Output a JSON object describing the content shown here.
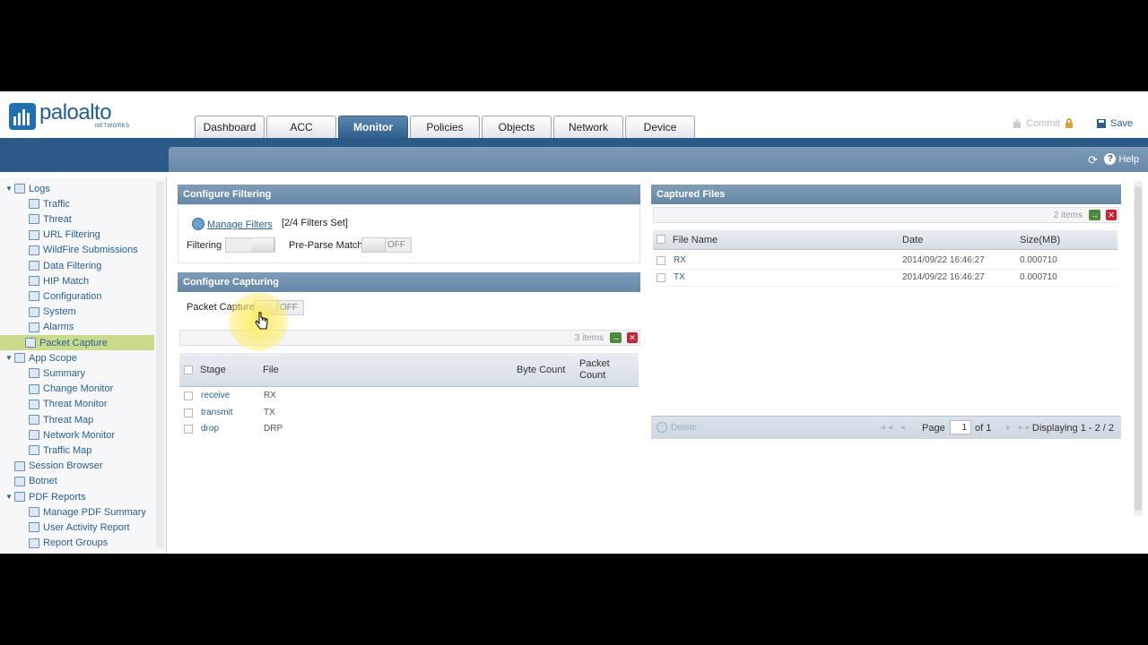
{
  "brand": {
    "name": "paloalto",
    "sub": "NETWORKS",
    "color": "#1f5e99"
  },
  "tabs": [
    {
      "label": "Dashboard",
      "active": false
    },
    {
      "label": "ACC",
      "active": false
    },
    {
      "label": "Monitor",
      "active": true
    },
    {
      "label": "Policies",
      "active": false
    },
    {
      "label": "Objects",
      "active": false
    },
    {
      "label": "Network",
      "active": false
    },
    {
      "label": "Device",
      "active": false
    }
  ],
  "header_actions": {
    "commit": "Commit",
    "save": "Save",
    "help": "Help"
  },
  "sidebar": {
    "items": [
      {
        "label": "Logs",
        "level": 0,
        "expanded": true
      },
      {
        "label": "Traffic",
        "level": 1
      },
      {
        "label": "Threat",
        "level": 1
      },
      {
        "label": "URL Filtering",
        "level": 1
      },
      {
        "label": "WildFire Submissions",
        "level": 1
      },
      {
        "label": "Data Filtering",
        "level": 1
      },
      {
        "label": "HIP Match",
        "level": 1
      },
      {
        "label": "Configuration",
        "level": 1
      },
      {
        "label": "System",
        "level": 1
      },
      {
        "label": "Alarms",
        "level": 1
      },
      {
        "label": "Packet Capture",
        "level": 0,
        "selected": true
      },
      {
        "label": "App Scope",
        "level": 0,
        "expanded": true
      },
      {
        "label": "Summary",
        "level": 1
      },
      {
        "label": "Change Monitor",
        "level": 1
      },
      {
        "label": "Threat Monitor",
        "level": 1
      },
      {
        "label": "Threat Map",
        "level": 1
      },
      {
        "label": "Network Monitor",
        "level": 1
      },
      {
        "label": "Traffic Map",
        "level": 1
      },
      {
        "label": "Session Browser",
        "level": 0
      },
      {
        "label": "Botnet",
        "level": 0
      },
      {
        "label": "PDF Reports",
        "level": 0,
        "expanded": true
      },
      {
        "label": "Manage PDF Summary",
        "level": 1
      },
      {
        "label": "User Activity Report",
        "level": 1
      },
      {
        "label": "Report Groups",
        "level": 1
      }
    ]
  },
  "configure_filtering": {
    "title": "Configure Filtering",
    "manage_filters": "Manage Filters",
    "filters_set": "[2/4 Filters Set]",
    "filtering_label": "Filtering",
    "preparse_label": "Pre-Parse Match",
    "preparse_state": "OFF"
  },
  "configure_capturing": {
    "title": "Configure Capturing",
    "packet_capture_label": "Packet Capture",
    "packet_capture_state": "OFF",
    "count": "3 items",
    "columns": [
      "Stage",
      "File",
      "Byte Count",
      "Packet Count"
    ],
    "rows": [
      {
        "stage": "receive",
        "file": "RX"
      },
      {
        "stage": "transmit",
        "file": "TX"
      },
      {
        "stage": "drop",
        "file": "DRP"
      }
    ]
  },
  "captured_files": {
    "title": "Captured Files",
    "count": "2 items",
    "columns": [
      "File Name",
      "Date",
      "Size(MB)"
    ],
    "rows": [
      {
        "name": "RX",
        "date": "2014/09/22 16:46:27",
        "size": "0.000710"
      },
      {
        "name": "TX",
        "date": "2014/09/22 16:46:27",
        "size": "0.000710"
      }
    ],
    "delete_label": "Delete",
    "page_label": "Page",
    "page_value": "1",
    "page_of": "of 1",
    "displaying": "Displaying 1 - 2 / 2"
  }
}
